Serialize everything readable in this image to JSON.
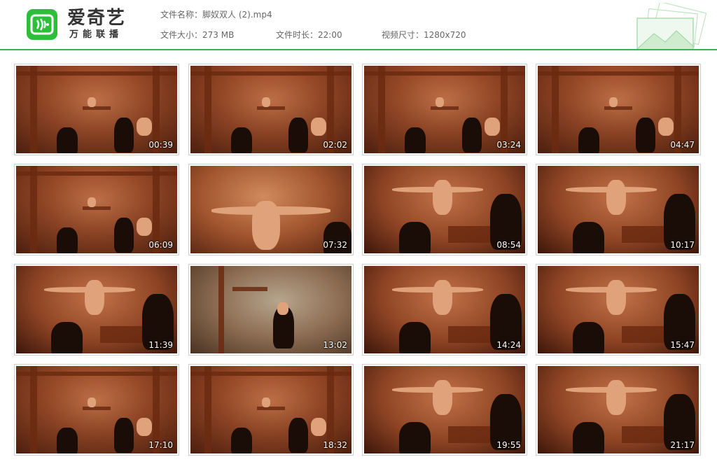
{
  "header": {
    "brand": "爱奇艺",
    "brand_sub": "万能联播",
    "file_name_label": "文件名称：",
    "file_name": "脚奴双人 (2).mp4",
    "file_size_label": "文件大小：",
    "file_size": "273 MB",
    "duration_label": "文件时长：",
    "duration": "22:00",
    "resolution_label": "视频尺寸：",
    "resolution": "1280x720"
  },
  "colors": {
    "accent": "#3fb34f",
    "logo_green": "#2dbf3a"
  },
  "icons": {
    "logo": "iqiyi-logo-icon",
    "deco": "stacked-images-icon"
  },
  "thumbnails": [
    {
      "time": "00:39",
      "scene": "a"
    },
    {
      "time": "02:02",
      "scene": "a"
    },
    {
      "time": "03:24",
      "scene": "a"
    },
    {
      "time": "04:47",
      "scene": "a"
    },
    {
      "time": "06:09",
      "scene": "a"
    },
    {
      "time": "07:32",
      "scene": "b"
    },
    {
      "time": "08:54",
      "scene": "c"
    },
    {
      "time": "10:17",
      "scene": "c"
    },
    {
      "time": "11:39",
      "scene": "c"
    },
    {
      "time": "13:02",
      "scene": "d"
    },
    {
      "time": "14:24",
      "scene": "c"
    },
    {
      "time": "15:47",
      "scene": "c"
    },
    {
      "time": "17:10",
      "scene": "a"
    },
    {
      "time": "18:32",
      "scene": "a"
    },
    {
      "time": "19:55",
      "scene": "c"
    },
    {
      "time": "21:17",
      "scene": "c"
    }
  ]
}
